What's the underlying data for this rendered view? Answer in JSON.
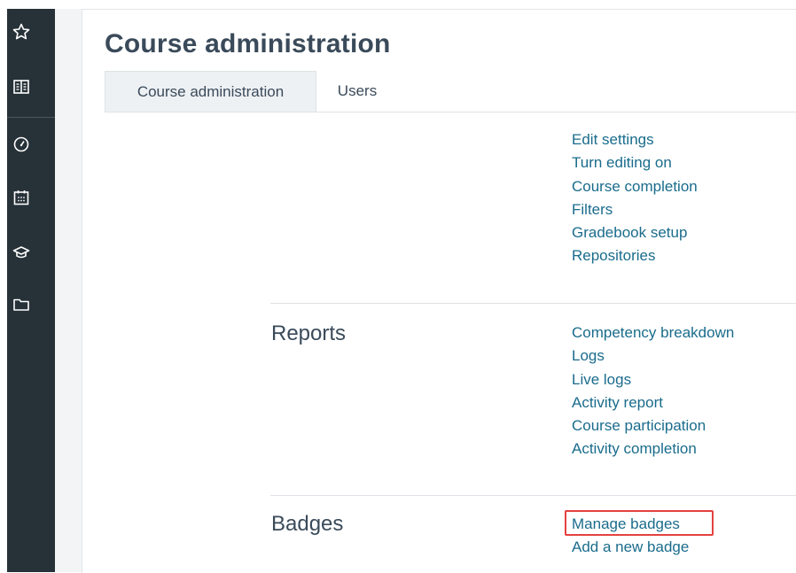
{
  "sidebar": {
    "icons": [
      "star-icon",
      "book-icon",
      "dashboard-icon",
      "calendar-icon",
      "graduation-cap-icon",
      "folder-icon"
    ]
  },
  "page": {
    "title": "Course administration"
  },
  "tabs": {
    "course_admin": "Course administration",
    "users": "Users"
  },
  "sections": {
    "general": {
      "links": [
        "Edit settings",
        "Turn editing on",
        "Course completion",
        "Filters",
        "Gradebook setup",
        "Repositories"
      ]
    },
    "reports": {
      "heading": "Reports",
      "links": [
        "Competency breakdown",
        "Logs",
        "Live logs",
        "Activity report",
        "Course participation",
        "Activity completion"
      ]
    },
    "badges": {
      "heading": "Badges",
      "links": [
        "Manage badges",
        "Add a new badge"
      ]
    }
  },
  "colors": {
    "sidebar_bg": "#263138",
    "link": "#1a6c8c",
    "title": "#3a4a5a",
    "highlight": "#e4423f"
  }
}
